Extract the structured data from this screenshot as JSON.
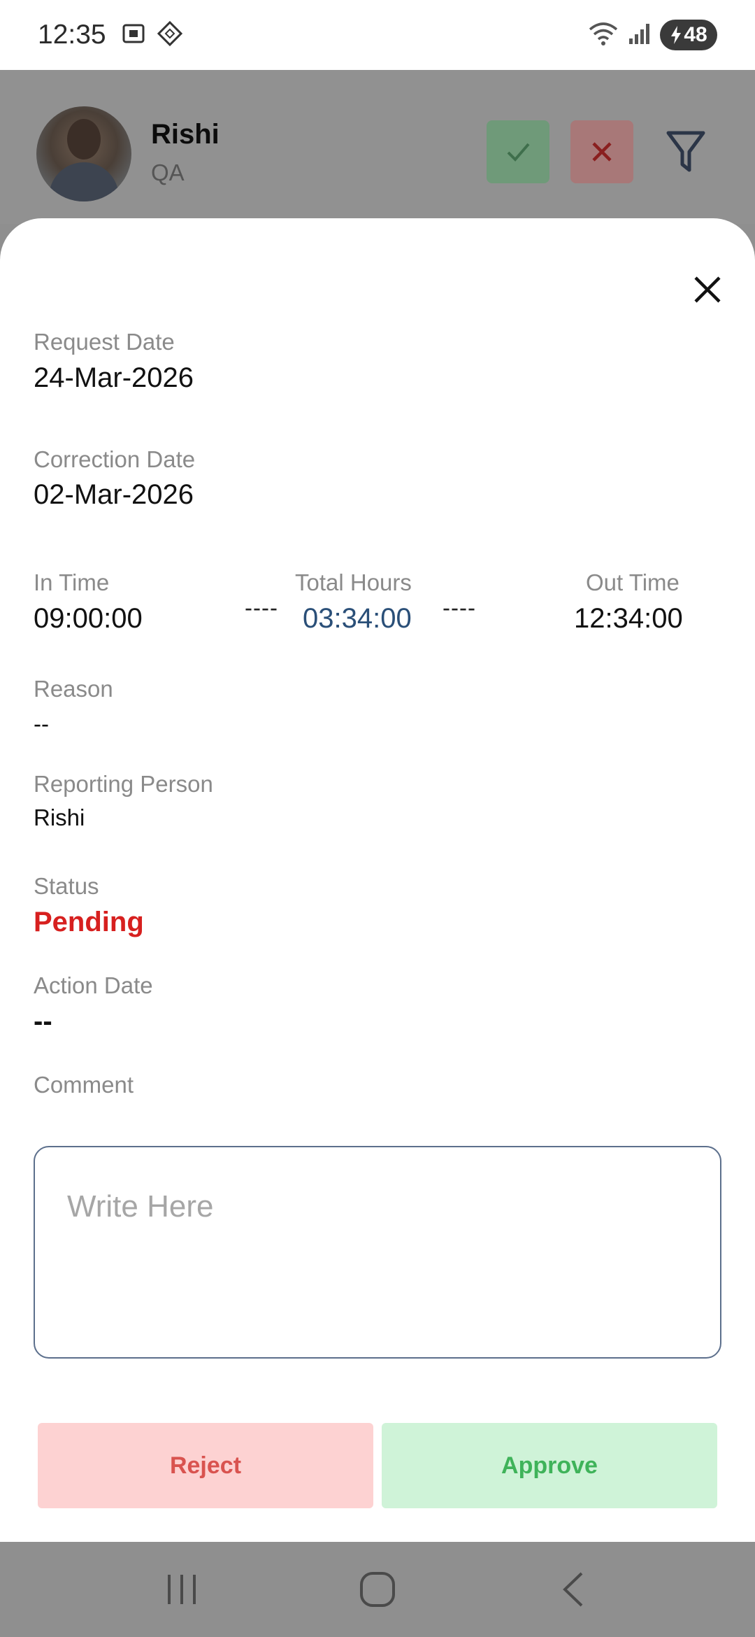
{
  "status_bar": {
    "time": "12:35",
    "battery": "48",
    "icons": [
      "screenshot-icon",
      "tag-icon",
      "wifi-icon",
      "signal-icon",
      "battery-icon"
    ]
  },
  "header": {
    "name": "Rishi",
    "role": "QA",
    "approve_icon": "check-icon",
    "reject_icon": "close-icon",
    "filter_icon": "filter-icon",
    "approve_color": "#6f9a79",
    "reject_color": "#a87878"
  },
  "details": {
    "request_date_label": "Request Date",
    "request_date": "24-Mar-2026",
    "correction_date_label": "Correction Date",
    "correction_date": "02-Mar-2026",
    "in_time_label": "In Time",
    "in_time": "09:00:00",
    "total_hours_label": "Total Hours",
    "total_hours": "03:34:00",
    "out_time_label": "Out Time",
    "out_time": "12:34:00",
    "separator": "----",
    "reason_label": "Reason",
    "reason": "--",
    "reporting_person_label": "Reporting Person",
    "reporting_person": "Rishi",
    "status_label": "Status",
    "status": "Pending",
    "status_color": "#d7201f",
    "action_date_label": "Action Date",
    "action_date": "--",
    "comment_label": "Comment",
    "comment_placeholder": "Write Here",
    "comment_value": ""
  },
  "actions": {
    "reject_label": "Reject",
    "approve_label": "Approve",
    "reject_bg": "#fdd2d2",
    "approve_bg": "#cff3d8"
  },
  "nav": {
    "recents_icon": "recents-icon",
    "home_icon": "home-icon",
    "back_icon": "back-icon"
  }
}
